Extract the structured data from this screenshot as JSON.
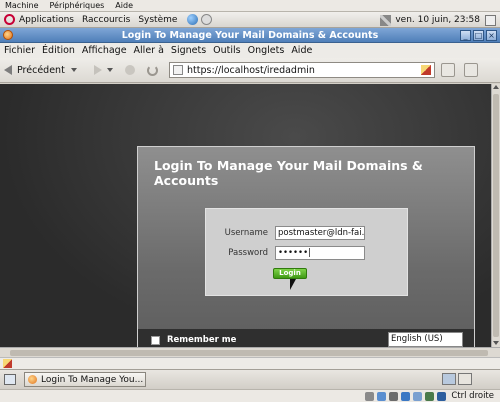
{
  "vm_menubar": {
    "items": [
      "Machine",
      "Périphériques",
      "Aide"
    ]
  },
  "gnome_panel": {
    "applications": "Applications",
    "places": "Raccourcis",
    "system": "Système",
    "clock": "ven. 10 juin, 23:58"
  },
  "window": {
    "title": "Login To Manage Your Mail Domains & Accounts"
  },
  "browser_menu": {
    "items": [
      "Fichier",
      "Édition",
      "Affichage",
      "Aller à",
      "Signets",
      "Outils",
      "Onglets",
      "Aide"
    ]
  },
  "navigation": {
    "back_label": "Précédent",
    "url": "https://localhost/iredadmin"
  },
  "login": {
    "heading": "Login To Manage Your Mail Domains & Accounts",
    "username_label": "Username",
    "username_value": "postmaster@ldn-fai.net",
    "password_label": "Password",
    "password_value": "••••••|",
    "button_label": "Login",
    "remember_label": "Remember me",
    "language_selected": "English (US)"
  },
  "taskbar": {
    "task_label": "Login To Manage You..."
  },
  "vm_status": {
    "host_key": "Ctrl droite"
  }
}
